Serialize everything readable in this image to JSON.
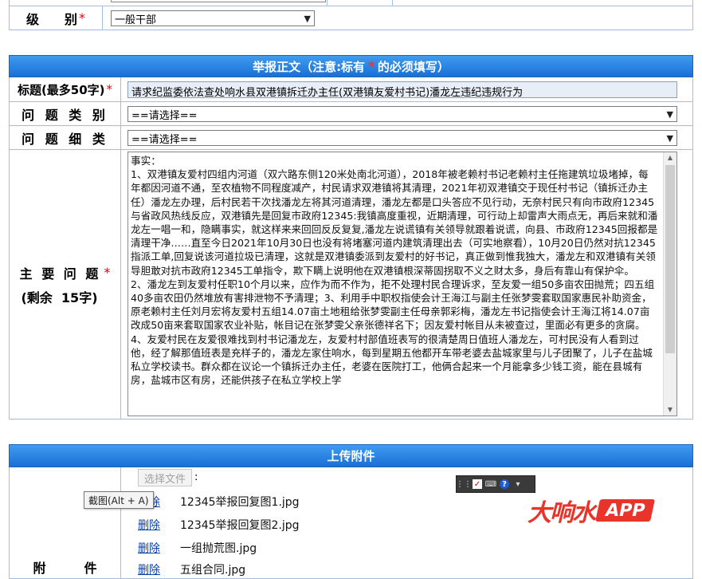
{
  "level_row": {
    "label": "级　　别",
    "required_mark": "*",
    "selected": "一般干部"
  },
  "report_section": {
    "header_prefix": "举报正文（注意:标有",
    "header_star": "*",
    "header_suffix": "的必须填写）",
    "title_label": "标题(最多50字)",
    "title_required": "*",
    "title_value": "请求纪监委依法查处响水县双港镇拆迁办主任(双港镇友爱村书记)潘龙左违纪违规行为",
    "category_label": "问 题 类 别",
    "category_selected": "==请选择==",
    "subcategory_label": "问 题 细 类",
    "subcategory_selected": "==请选择==",
    "main_issue_label": "主 要 问 题",
    "main_issue_required": "*",
    "remaining_label": "(剩余  15字)",
    "main_issue_text": "事实：\n1、双港镇友爱村四组内河道（双六路东侧120米处南北河道），2018年被老赖村书记老赖村主任拖建筑垃圾堵掉，每年都因河道不通，至农植物不同程度减产，村民请求双港镇将其清理，2021年初双港镇交于现任村书记（镇拆迁办主任）潘龙左办理，后村民若干次找潘龙左将其河道清理，潘龙左都是口头答应不见行动，无奈村民只有向市政府12345与省政风热线反应，双港镇先是回复市政府12345:我镇高度重视，近期清理，可行动上却雷声大雨点无，再后来就和潘龙左一唱一和，隐瞒事实，就这样来来回回反反复复,潘龙左说谎镇有关领导就跟着说谎，向县、市政府12345回报都是清理干净……直至今日2021年10月30日也没有将堵塞河道内建筑清理出去（可实地察看），10月20日仍然对抗12345指派工单,回复说该河道拉圾已清理，这就是双港镇委派到友爱村的好书记，真正做到惟我独大，潘龙左和双港镇有关领导胆敢对抗市政府12345工单指令，欺下瞒上说明他在双港镇根深蒂固拐取不义之财太多，身后有靠山有保护伞。\n2、潘龙左到友爱村任职10个月以来，应作为而不作为，拒不处理村民合理诉求，至友爱一组50多亩农田抛荒；四五组40多亩农田仍然堆放有害排泄物不予清理；3、利用手中职权指使会计王海江与副主任张梦雯套取国家惠民补助资金，原老赖村主任刘月宏将友爱村五组14.07亩土地租给张梦雯副主任母亲郭彩梅，潘龙左书记指使会计王海江将14.07亩改成50亩来套取国家农业补贴，帐目记在张梦雯父亲张德祥名下；因友爱村帐目从未被查过，里面必有更多的贪腐。4、友爱村民在友爱很难找到村书记潘龙左，友爱村村部值班表写的很清楚周日值班人潘龙左，可村民没有人看到过他，经了解那值班表是充样子的，潘龙左家住响水，每到星期五他都开车带老婆去盐城家里与儿子团聚了，儿子在盐城私立学校读书。群众都在议论一个镇拆迁办主任，老婆在医院打工，他俩合起来一个月能拿多少钱工资，能在县城有房，盐城市区有房，还能供孩子在私立学校上学"
  },
  "upload_section": {
    "header": "上传附件",
    "choose_button": "选择文件",
    "choose_after": ":",
    "attachment_label": "附　　　件",
    "delete_label": "删除",
    "files": [
      "12345举报回复图1.jpg",
      "12345举报回复图2.jpg",
      "一组抛荒图.jpg",
      "五组合同.jpg"
    ],
    "tooltip": "截图(Alt + A)"
  },
  "watermark": {
    "brand_cn": "大响水",
    "brand_app": "APP"
  },
  "colors": {
    "header_blue": "#1a6fd6",
    "border_blue": "#9ec1e3",
    "required_red": "#e60012",
    "brand_red": "#e8342a"
  }
}
